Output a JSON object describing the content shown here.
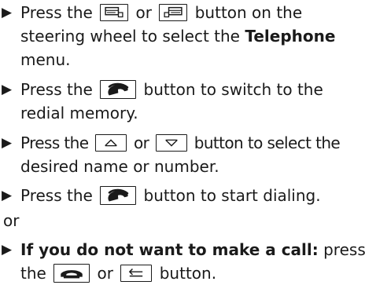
{
  "steps": [
    {
      "lines": [
        {
          "a": "Press the",
          "b": "or",
          "c": "button on the"
        },
        {
          "a": "steering wheel to select the",
          "bold": "Telephone"
        },
        {
          "a": "menu."
        }
      ]
    },
    {
      "lines": [
        {
          "a": "Press the",
          "c": "button to switch to the"
        },
        {
          "a": "redial memory."
        }
      ]
    },
    {
      "lines": [
        {
          "a": "Press the",
          "b": "or",
          "c": "button to select the"
        },
        {
          "a": "desired name or number."
        }
      ]
    },
    {
      "lines": [
        {
          "a": "Press the",
          "c": "button to start dialing."
        }
      ]
    }
  ],
  "or_text": "or",
  "last_step": {
    "bold": "If you do not want to make a call:",
    "rest": "press",
    "line2a": "the",
    "line2b": "or",
    "line2c": "button."
  },
  "bullet": "▶",
  "icons": {
    "page_back": "display-page-back-icon",
    "page_forward": "display-page-forward-icon",
    "phone_pickup": "phone-pickup-icon",
    "arrow_up": "arrow-up-icon",
    "arrow_down": "arrow-down-icon",
    "phone_hangup": "phone-hangup-icon",
    "back": "back-arrow-icon"
  }
}
